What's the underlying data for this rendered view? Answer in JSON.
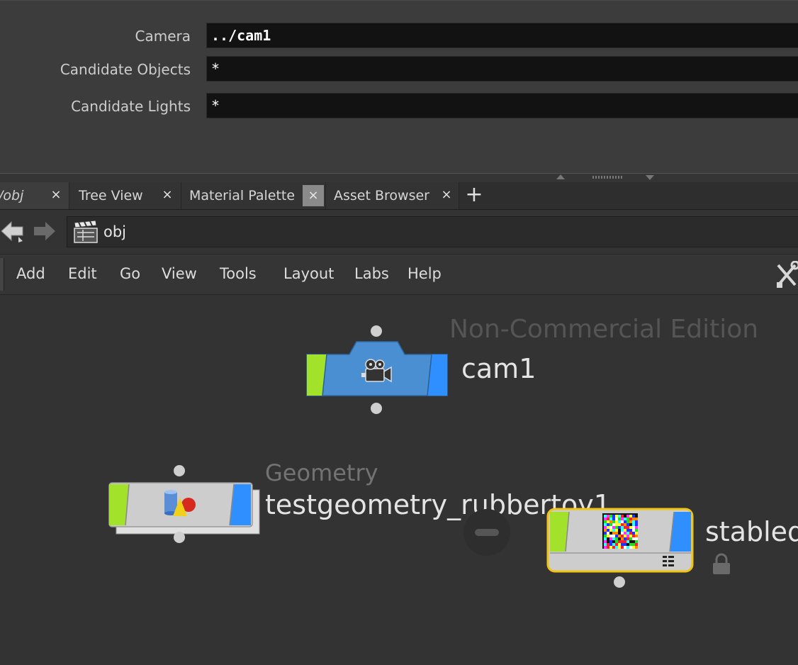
{
  "params": {
    "camera": {
      "label": "Camera",
      "value": "../cam1"
    },
    "candidate_objects": {
      "label": "Candidate Objects",
      "value": "*"
    },
    "candidate_lights": {
      "label": "Candidate Lights",
      "value": "*"
    }
  },
  "tabs": [
    {
      "label": "/obj",
      "close": "×"
    },
    {
      "label": "Tree View",
      "close": "×"
    },
    {
      "label": "Material Palette",
      "close": "×"
    },
    {
      "label": "Asset Browser",
      "close": "×"
    }
  ],
  "tab_add": "+",
  "path": {
    "text": "obj"
  },
  "menu": [
    "Add",
    "Edit",
    "Go",
    "View",
    "Tools",
    "Layout",
    "Labs",
    "Help"
  ],
  "network": {
    "watermark": "Non-Commercial Edition",
    "nodes": {
      "cam1": {
        "name": "cam1",
        "icon": "camera-icon"
      },
      "geo": {
        "type": "Geometry",
        "name": "testgeometry_rubbertoy1",
        "icon": "geometry-shapes-icon"
      },
      "stable": {
        "name": "stabled",
        "icon": "noise-texture-icon"
      }
    }
  },
  "colors": {
    "accent_green": "#a3e22a",
    "accent_blue": "#2f8fff",
    "camera_node": "#4a8fd1",
    "geometry_node": "#cdcdcd",
    "selected_outline": "#f2c412"
  }
}
